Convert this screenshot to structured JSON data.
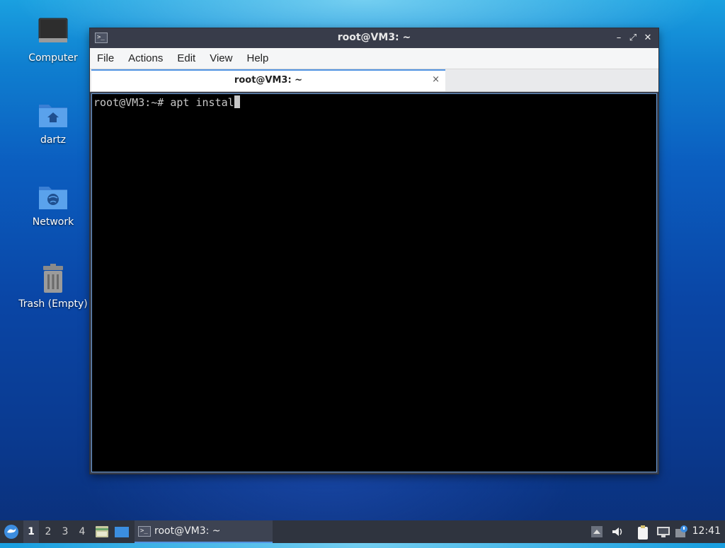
{
  "desktop": {
    "icons": [
      {
        "label": "Computer"
      },
      {
        "label": "dartz"
      },
      {
        "label": "Network"
      },
      {
        "label": "Trash (Empty)"
      }
    ]
  },
  "window": {
    "title": "root@VM3: ~",
    "buttons": {
      "minimize": "–",
      "maximize": "⤢",
      "close": "✕"
    },
    "menu": [
      "File",
      "Actions",
      "Edit",
      "View",
      "Help"
    ],
    "tab": {
      "label": "root@VM3: ~",
      "close": "×"
    },
    "terminal": {
      "prompt": "root@VM3:~# ",
      "command": "apt instal"
    }
  },
  "taskbar": {
    "workspaces": [
      "1",
      "2",
      "3",
      "4"
    ],
    "active_workspace": "1",
    "task_label": "root@VM3: ~",
    "clock": "12:41"
  },
  "colors": {
    "accent": "#5294e2",
    "titlebar": "#383c4a",
    "taskbar": "#2f343f",
    "terminal_bg": "#000000",
    "terminal_fg": "#c8c8c8"
  }
}
